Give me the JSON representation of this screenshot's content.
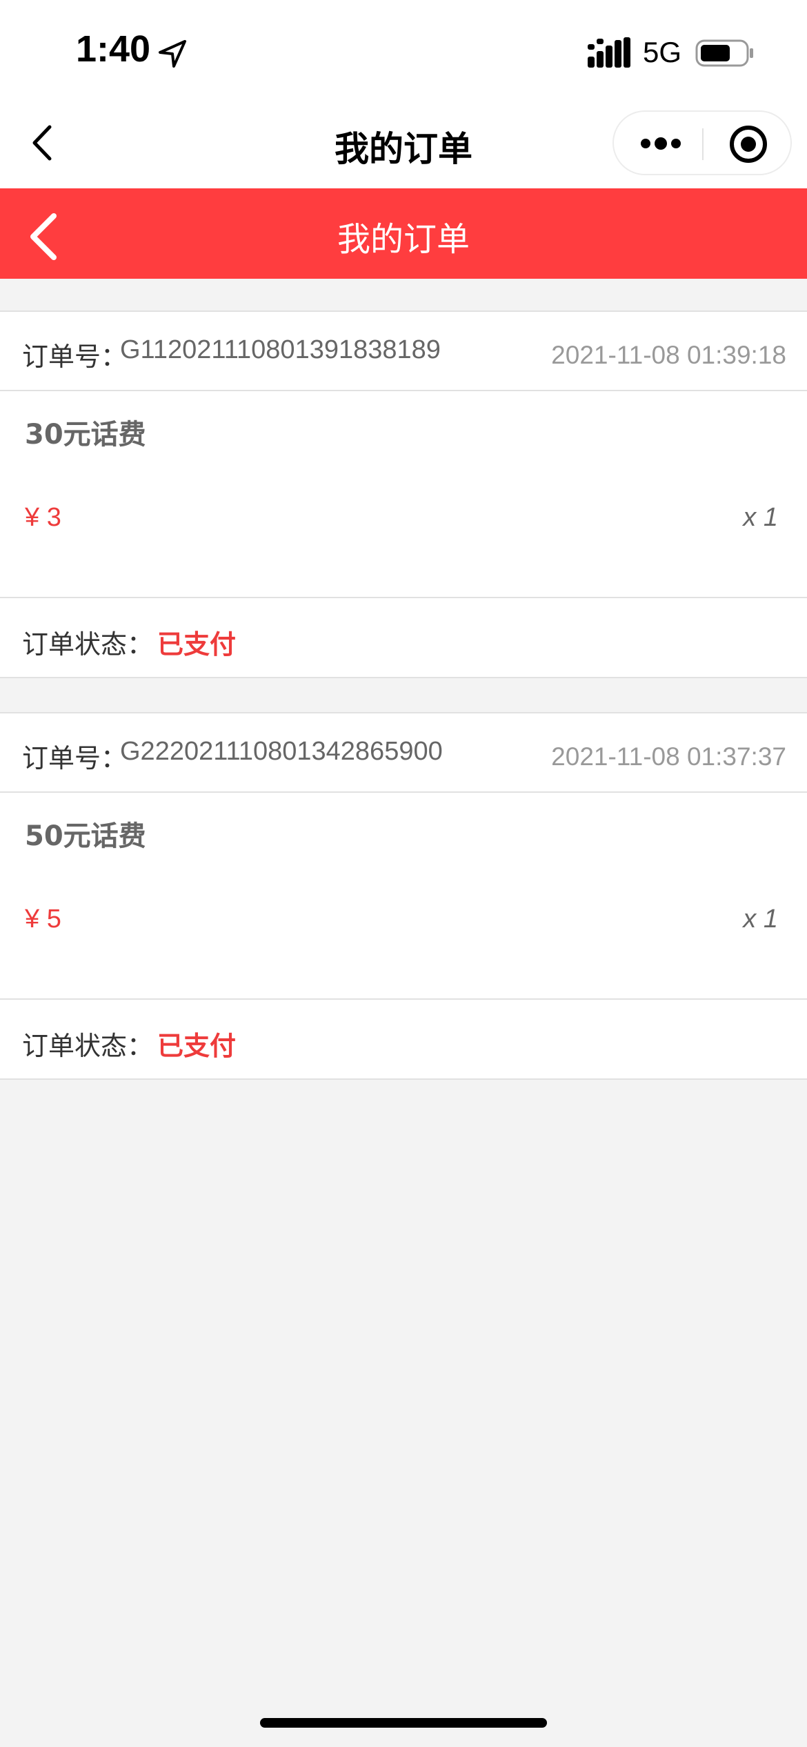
{
  "status_bar": {
    "time": "1:40",
    "network": "5G",
    "icons": [
      "location-arrow-icon",
      "signal-icon",
      "battery-icon"
    ]
  },
  "nav_bar": {
    "title": "我的订单",
    "icons": [
      "back-icon",
      "more-icon",
      "target-icon"
    ]
  },
  "header": {
    "title": "我的订单",
    "color": "#ff3d3f",
    "back_icon": "back-icon"
  },
  "orders": [
    {
      "order_no_label": "订单号：",
      "order_no": "G112021110801391838189",
      "time": "2021-11-08 01:39:18",
      "product": "30元话费",
      "price": "¥ 3",
      "quantity": "x 1",
      "status_label": "订单状态：",
      "status": "已支付"
    },
    {
      "order_no_label": "订单号：",
      "order_no": "G222021110801342865900",
      "time": "2021-11-08 01:37:37",
      "product": "50元话费",
      "price": "¥ 5",
      "quantity": "x 1",
      "status_label": "订单状态：",
      "status": "已支付"
    }
  ],
  "colors": {
    "accent": "#ff3d3f",
    "price": "#ee3b3b",
    "background": "#f3f3f3"
  }
}
